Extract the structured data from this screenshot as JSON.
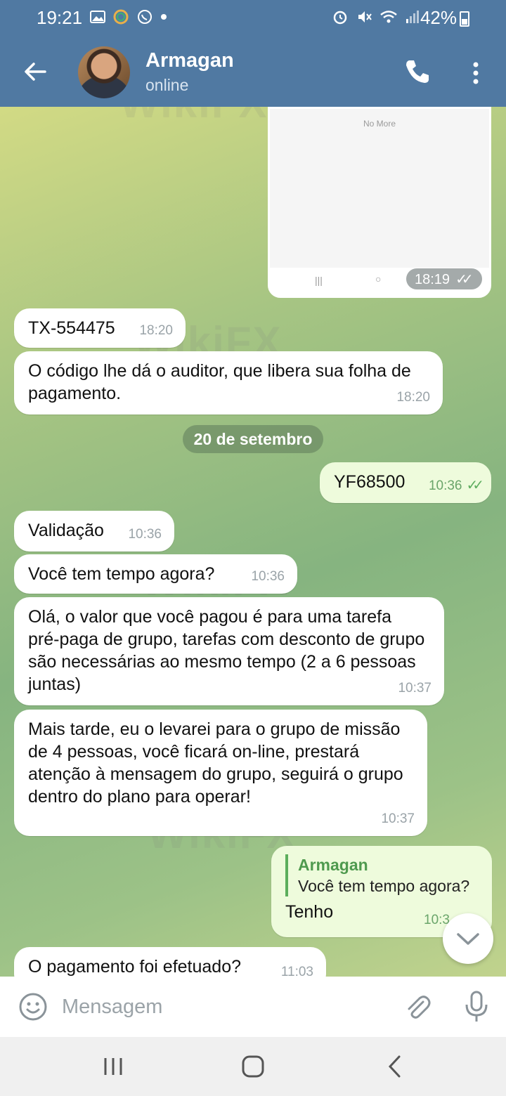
{
  "status_bar": {
    "time": "19:21",
    "battery": "42%"
  },
  "header": {
    "contact_name": "Armagan",
    "contact_status": "online"
  },
  "screenshot_image": {
    "caption": "No More",
    "time": "18:19"
  },
  "messages_before": [
    {
      "text": "TX-554475",
      "time": "18:20",
      "direction": "in"
    },
    {
      "text": "O código lhe dá o auditor, que libera sua folha de pagamento.",
      "time": "18:20",
      "direction": "in"
    }
  ],
  "date_separator": "20 de setembro",
  "messages_after": [
    {
      "text": "YF68500",
      "time": "10:36",
      "direction": "out"
    },
    {
      "text": "Validação",
      "time": "10:36",
      "direction": "in"
    },
    {
      "text": "Você tem tempo agora?",
      "time": "10:36",
      "direction": "in"
    },
    {
      "text": "Olá, o valor que você pagou é para uma tarefa pré-paga de grupo, tarefas com desconto de grupo são necessárias ao mesmo tempo (2 a 6 pessoas juntas)",
      "time": "10:37",
      "direction": "in"
    },
    {
      "text": "Mais tarde, eu o levarei para o grupo de missão de 4 pessoas, você ficará on-line, prestará atenção à mensagem do grupo, seguirá o grupo dentro do plano para operar!",
      "time": "10:37",
      "direction": "in"
    },
    {
      "reply_to_name": "Armagan",
      "reply_to_text": "Você tem tempo agora?",
      "text": "Tenho",
      "time": "10:3",
      "direction": "out"
    },
    {
      "text": "O pagamento foi efetuado?",
      "time": "11:03",
      "direction": "in"
    }
  ],
  "input": {
    "placeholder": "Mensagem"
  },
  "watermark": "WikiFX",
  "colors": {
    "header": "#5079a2",
    "outgoing_bubble": "#eefbdc",
    "incoming_bubble": "#ffffff",
    "tick": "#5fae60"
  }
}
